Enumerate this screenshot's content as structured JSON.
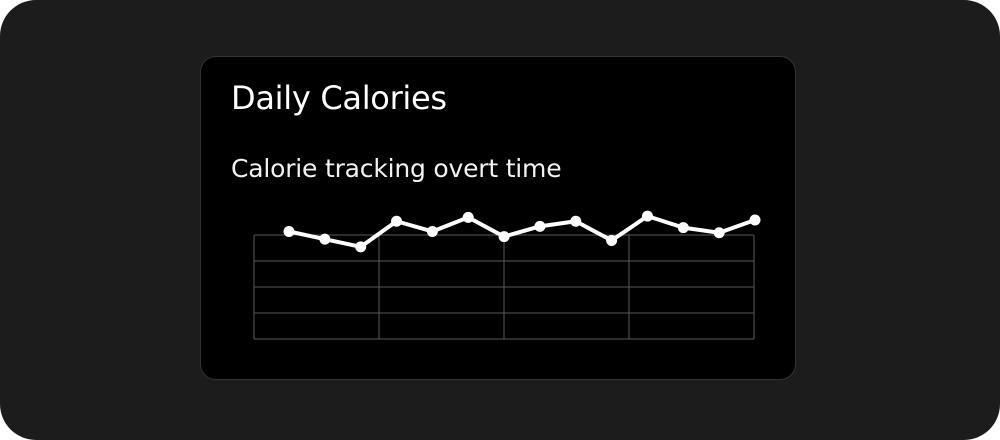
{
  "card": {
    "title": "Daily Calories",
    "subtitle": "Calorie tracking overt time"
  },
  "colors": {
    "page_background": "#1c1c1c",
    "card_background": "#000000",
    "card_border": "#333333",
    "text": "#ffffff",
    "line": "#ffffff",
    "grid": "#5a5a5a"
  },
  "chart_data": {
    "type": "line",
    "x": [
      1,
      2,
      3,
      4,
      5,
      6,
      7,
      8,
      9,
      10,
      11,
      12,
      13,
      14
    ],
    "series": [
      {
        "values": [
          84,
          78,
          72,
          92,
          84,
          95,
          80,
          88,
          92,
          77,
          96,
          87,
          83,
          93
        ]
      }
    ],
    "ylim": [
      0,
      100
    ],
    "grid": true,
    "grid_rows": 4,
    "grid_cols": 4,
    "legend": "none",
    "xlabel": "",
    "ylabel": ""
  }
}
